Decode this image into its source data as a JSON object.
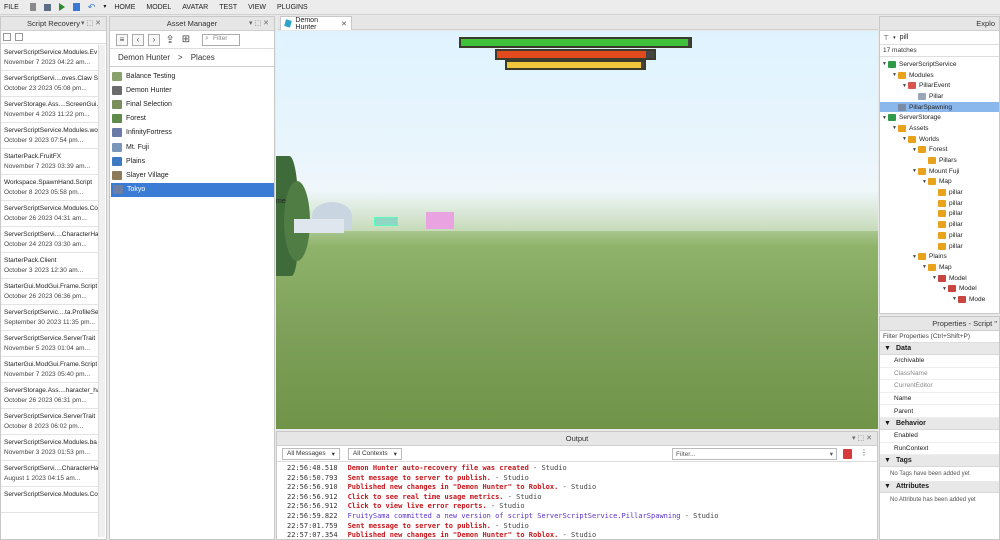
{
  "menubar": {
    "items": [
      "FILE",
      "HOME",
      "MODEL",
      "AVATAR",
      "TEST",
      "VIEW",
      "PLUGINS"
    ]
  },
  "recovery": {
    "title": "Script Recovery",
    "items": [
      {
        "name": "ServerScriptService.Modules.Ev",
        "date": "November 7 2023 04:22 am..."
      },
      {
        "name": "ServerScriptServi....oves.Claw Sk",
        "date": "October 23 2023 05:08 pm..."
      },
      {
        "name": "ServerStorage.Ass....ScreenGui.S",
        "date": "November 4 2023 11:22 pm..."
      },
      {
        "name": "ServerScriptService.Modules.wo",
        "date": "October 9 2023 07:54 pm..."
      },
      {
        "name": "StarterPack.FruitFX",
        "date": "November 7 2023 03:39 am..."
      },
      {
        "name": "Workspace.SpawnHand.Script",
        "date": "October 8 2023 05:58 pm..."
      },
      {
        "name": "ServerScriptService.Modules.Co",
        "date": "October 26 2023 04:31 am..."
      },
      {
        "name": "ServerScriptServi....CharacterHa",
        "date": "October 24 2023 03:30 am..."
      },
      {
        "name": "StarterPack.Client",
        "date": "October 3 2023 12:30 am..."
      },
      {
        "name": "StarterGui.ModGui.Frame.Script",
        "date": "October 26 2023 06:36 pm..."
      },
      {
        "name": "ServerScriptServic....ta.ProfileSe",
        "date": "September 30 2023 11:35 pm..."
      },
      {
        "name": "ServerScriptService.ServerTrait",
        "date": "November 5 2023 01:04 am..."
      },
      {
        "name": "StarterGui.ModGui.Frame.Script",
        "date": "November 7 2023 05:40 pm..."
      },
      {
        "name": "ServerStorage.Ass....haracter_ha",
        "date": "October 26 2023 06:31 pm..."
      },
      {
        "name": "ServerScriptService.ServerTrait",
        "date": "October 8 2023 06:02 pm..."
      },
      {
        "name": "ServerScriptService.Modules.ba",
        "date": "November 3 2023 01:53 pm..."
      },
      {
        "name": "ServerScriptServi....CharacterHa",
        "date": "August 1 2023 04:15 am..."
      },
      {
        "name": "ServerScriptService.Modules.Co",
        "date": ""
      }
    ]
  },
  "assets": {
    "title": "Asset Manager",
    "filter_placeholder": "Filter",
    "breadcrumb": {
      "root": "Demon Hunter",
      "sep": ">",
      "current": "Places"
    },
    "items": [
      {
        "label": "Balance Testing",
        "color": "#8aa26e"
      },
      {
        "label": "Demon Hunter",
        "color": "#6b6b6b"
      },
      {
        "label": "Final Selection",
        "color": "#7b8f5c"
      },
      {
        "label": "Forest",
        "color": "#5f8a49"
      },
      {
        "label": "InfinityFortress",
        "color": "#6a7aa6"
      },
      {
        "label": "Mt. Fuji",
        "color": "#7a96b8"
      },
      {
        "label": "Plains",
        "color": "#3d7ac2"
      },
      {
        "label": "Slayer Village",
        "color": "#8c7a58"
      },
      {
        "label": "Tokyo",
        "color": "#6d7fa3"
      }
    ],
    "selected": "Tokyo"
  },
  "game_tab": {
    "label": "Demon Hunter"
  },
  "viewport": {
    "edge_text": "me",
    "bars": [
      {
        "color": "#3fc03a",
        "fill": 0.99
      },
      {
        "color": "#e04a1c",
        "fill": 0.95
      },
      {
        "color": "#f2c63a",
        "fill": 0.98
      }
    ]
  },
  "output": {
    "title": "Output",
    "messages_filter": "All Messages",
    "contexts_filter": "All Contexts",
    "filter_placeholder": "Filter...",
    "lines": [
      {
        "time": "22:56:48.518",
        "msg": "Demon Hunter auto-recovery file was created",
        "src": "  -  Studio",
        "style": "red"
      },
      {
        "time": "22:56:50.793",
        "msg": "Sent message to server to publish.",
        "src": "  -  Studio",
        "style": "red"
      },
      {
        "time": "22:56:56.910",
        "msg": "Published new changes in \"Demon Hunter\" to Roblox.",
        "src": "  -  Studio",
        "style": "red"
      },
      {
        "time": "22:56:56.912",
        "msg": "Click to see real time usage metrics.",
        "src": "  -  Studio",
        "style": "red"
      },
      {
        "time": "22:56:56.912",
        "msg": "Click to view live error reports.",
        "src": "  -  Studio",
        "style": "red"
      },
      {
        "time": "22:56:59.822",
        "msg": "FruitySama committed a new version of script ServerScriptService.PillarSpawning",
        "src": "  -  Studio",
        "style": "purple"
      },
      {
        "time": "22:57:01.759",
        "msg": "Sent message to server to publish.",
        "src": "  -  Studio",
        "style": "red"
      },
      {
        "time": "22:57:07.354",
        "msg": "Published new changes in \"Demon Hunter\" to Roblox.",
        "src": "  -  Studio",
        "style": "red"
      }
    ]
  },
  "explorer": {
    "title": "Explo",
    "filter_value": "pill",
    "count": "17 matches",
    "nodes": [
      {
        "label": "ServerScriptService",
        "depth": 0,
        "arrow": "▼",
        "icon": "#2f9a48"
      },
      {
        "label": "Modules",
        "depth": 1,
        "arrow": "▼",
        "icon": "#e8a21c"
      },
      {
        "label": "PillarEvent",
        "depth": 2,
        "arrow": "▼",
        "icon": "#d9534f"
      },
      {
        "label": "Pillar",
        "depth": 3,
        "arrow": "",
        "icon": "#9aa7b6"
      },
      {
        "label": "PillarSpawning",
        "depth": 1,
        "arrow": "",
        "icon": "#7b8da6",
        "selected": true
      },
      {
        "label": "ServerStorage",
        "depth": 0,
        "arrow": "▼",
        "icon": "#2f9a48"
      },
      {
        "label": "Assets",
        "depth": 1,
        "arrow": "▼",
        "icon": "#e8a21c"
      },
      {
        "label": "Worlds",
        "depth": 2,
        "arrow": "▼",
        "icon": "#e8a21c"
      },
      {
        "label": "Forest",
        "depth": 3,
        "arrow": "▼",
        "icon": "#e8a21c"
      },
      {
        "label": "Pillars",
        "depth": 4,
        "arrow": "",
        "icon": "#e8a21c"
      },
      {
        "label": "Mount Fuji",
        "depth": 3,
        "arrow": "▼",
        "icon": "#e8a21c"
      },
      {
        "label": "Map",
        "depth": 4,
        "arrow": "▼",
        "icon": "#e8a21c"
      },
      {
        "label": "pillar",
        "depth": 5,
        "arrow": "",
        "icon": "#e8a21c"
      },
      {
        "label": "pillar",
        "depth": 5,
        "arrow": "",
        "icon": "#e8a21c"
      },
      {
        "label": "pillar",
        "depth": 5,
        "arrow": "",
        "icon": "#e8a21c"
      },
      {
        "label": "pillar",
        "depth": 5,
        "arrow": "",
        "icon": "#e8a21c"
      },
      {
        "label": "pillar",
        "depth": 5,
        "arrow": "",
        "icon": "#e8a21c"
      },
      {
        "label": "pillar",
        "depth": 5,
        "arrow": "",
        "icon": "#e8a21c"
      },
      {
        "label": "Plains",
        "depth": 3,
        "arrow": "▼",
        "icon": "#e8a21c"
      },
      {
        "label": "Map",
        "depth": 4,
        "arrow": "▼",
        "icon": "#e8a21c"
      },
      {
        "label": "Model",
        "depth": 5,
        "arrow": "▼",
        "icon": "#c9453f"
      },
      {
        "label": "Model",
        "depth": 6,
        "arrow": "▼",
        "icon": "#c9453f"
      },
      {
        "label": "Mode",
        "depth": 7,
        "arrow": "▼",
        "icon": "#c9453f"
      }
    ]
  },
  "properties": {
    "title": "Properties - Script \"",
    "filter_placeholder": "Filter Properties (Ctrl+Shift+P)",
    "sections": {
      "data": "Data",
      "behavior": "Behavior",
      "tags": "Tags",
      "attributes": "Attributes"
    },
    "data_rows": [
      "Archivable",
      "ClassName",
      "CurrentEditor",
      "Name",
      "Parent"
    ],
    "behavior_rows": [
      "Enabled",
      "RunContext"
    ],
    "tags_note": "No Tags have been added yet",
    "attributes_note": "No Attribute has been added yet"
  }
}
